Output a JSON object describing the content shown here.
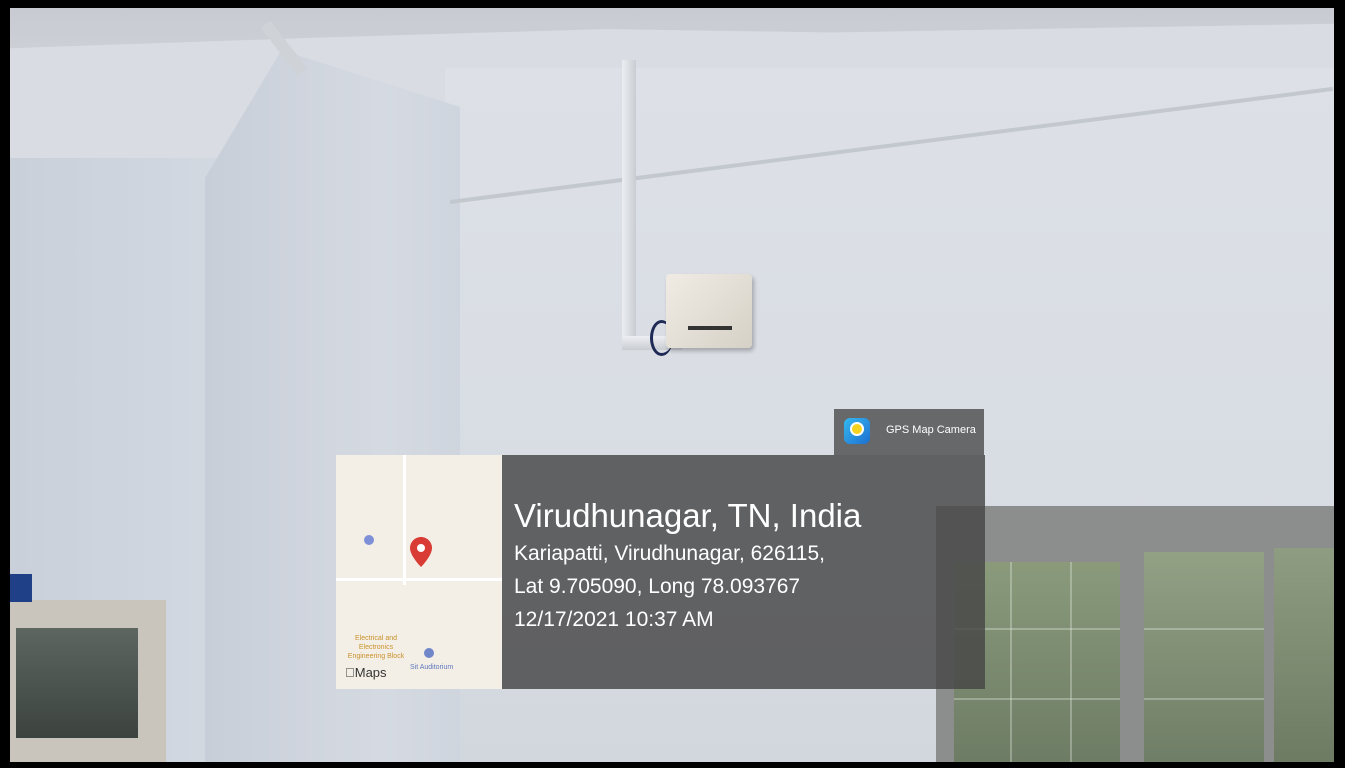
{
  "overlay": {
    "brand": {
      "label": "GPS Map Camera",
      "icon": "gps-map-camera-app-icon"
    },
    "place_title": "Virudhunagar, TN, India",
    "address": "Kariapatti, Virudhunagar, 626115,",
    "coordinates": "Lat 9.705090, Long 78.093767",
    "datetime": "12/17/2021 10:37 AM"
  },
  "map": {
    "labels": [
      "Electrical and Electronics Engineering Block",
      "Sit Auditorium"
    ],
    "logo": "Maps",
    "pin_icon": "location-pin-icon",
    "pin_color": "#d93b35"
  }
}
